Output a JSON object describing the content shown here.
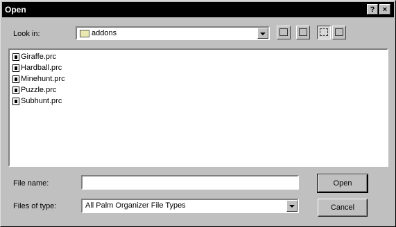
{
  "window": {
    "title": "Open",
    "help_label": "?",
    "close_label": "×"
  },
  "lookin": {
    "label": "Look in:",
    "value": "addons"
  },
  "toolbar": {
    "up_folder_icon": "up-folder-icon",
    "new_folder_icon": "new-folder-icon",
    "list_view_icon": "list-view-icon",
    "details_view_icon": "details-view-icon"
  },
  "files": [
    {
      "name": "Giraffe.prc"
    },
    {
      "name": "Hardball.prc"
    },
    {
      "name": "Minehunt.prc"
    },
    {
      "name": "Puzzle.prc"
    },
    {
      "name": "Subhunt.prc"
    }
  ],
  "filename": {
    "label": "File name:",
    "value": ""
  },
  "filetype": {
    "label": "Files of type:",
    "value": "All Palm Organizer File Types"
  },
  "buttons": {
    "open": "Open",
    "cancel": "Cancel"
  }
}
